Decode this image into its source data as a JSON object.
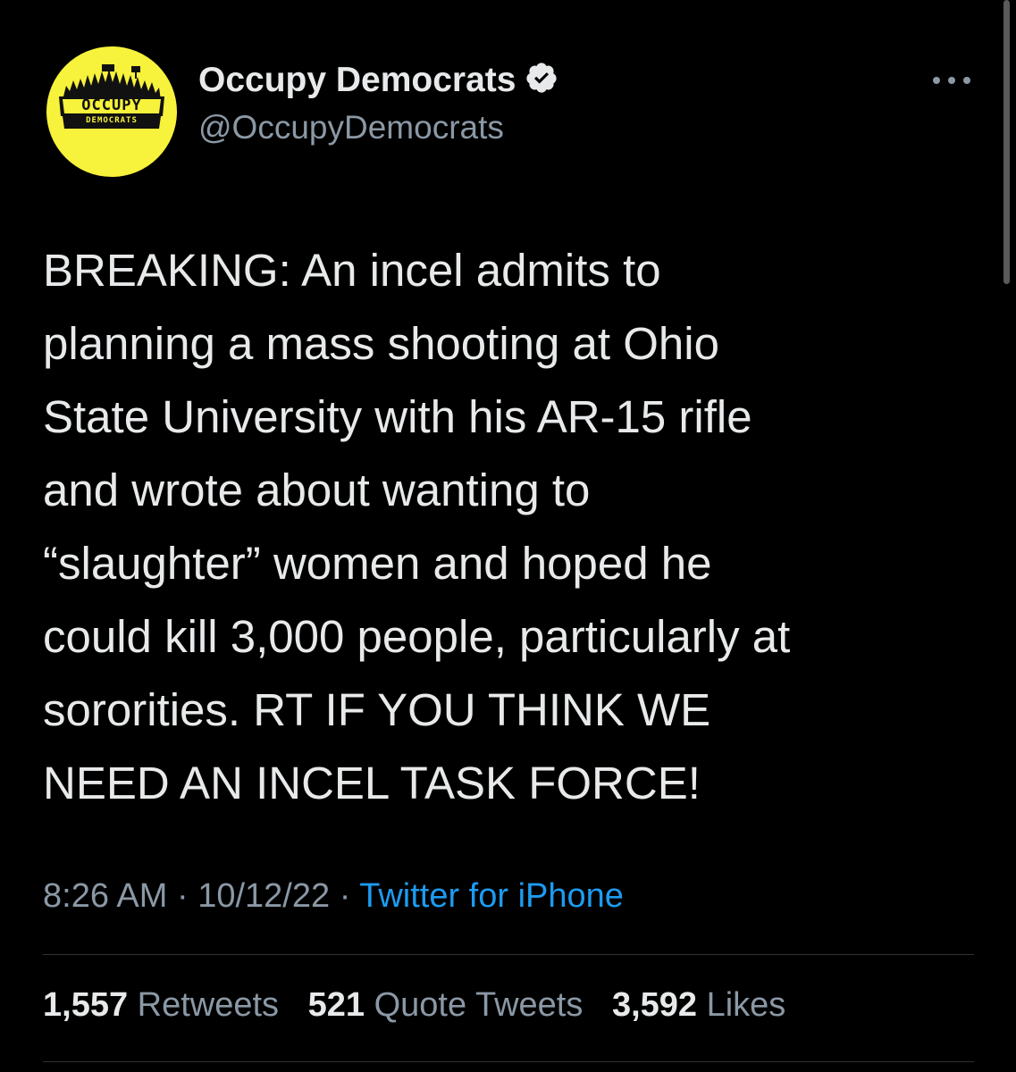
{
  "author": {
    "display_name": "Occupy Democrats",
    "handle": "@OccupyDemocrats",
    "avatar_text_top": "OCCUPY",
    "avatar_text_bottom": "DEMOCRATS",
    "avatar_color": "#f7f23b",
    "verified_icon": "verified-badge-icon"
  },
  "more_icon": "more-horizontal-icon",
  "tweet": {
    "lines": [
      "BREAKING: An incel admits to",
      "planning a mass shooting at Ohio",
      "State University with his AR-15 rifle",
      "and wrote about wanting to",
      "“slaughter” women and hoped he",
      "could kill 3,000 people, particularly at",
      "sororities. RT IF YOU THINK WE",
      "NEED AN INCEL TASK FORCE!"
    ]
  },
  "meta": {
    "time": "8:26 AM",
    "separator": "·",
    "date": "10/12/22",
    "source": "Twitter for iPhone"
  },
  "stats": {
    "retweets_count": "1,557",
    "retweets_label": "Retweets",
    "quotes_count": "521",
    "quotes_label": "Quote Tweets",
    "likes_count": "3,592",
    "likes_label": "Likes"
  },
  "colors": {
    "background": "#000000",
    "text_primary": "#e7e9ea",
    "text_secondary": "#8b98a5",
    "link": "#1d9bf0",
    "divider": "#2f3336"
  }
}
